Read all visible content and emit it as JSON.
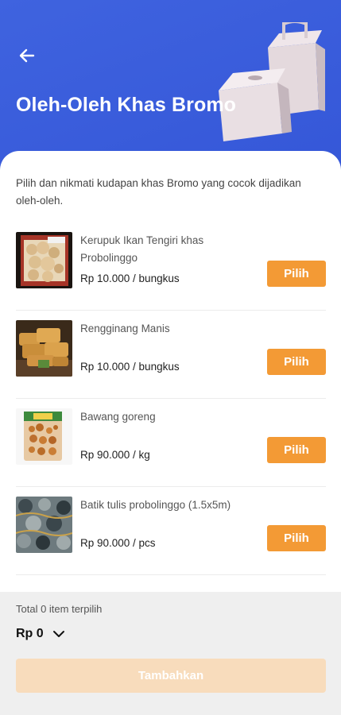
{
  "header": {
    "title": "Oleh-Oleh Khas Bromo",
    "back_icon": "arrow-left-icon",
    "illustration": "gift-boxes-illustration",
    "background_color": "#3f63df"
  },
  "intro_text": "Pilih dan nikmati kudapan khas Bromo yang cocok dijadikan oleh-oleh.",
  "products": [
    {
      "name": "Kerupuk Ikan Tengiri khas Probolinggo",
      "price": "Rp 10.000 / bungkus",
      "button": "Pilih",
      "image": "kerupuk-image"
    },
    {
      "name": "Rengginang Manis",
      "price": "Rp 10.000 / bungkus",
      "button": "Pilih",
      "image": "rengginang-image"
    },
    {
      "name": "Bawang goreng",
      "price": "Rp 90.000 / kg",
      "button": "Pilih",
      "image": "bawang-goreng-image"
    },
    {
      "name": "Batik tulis probolinggo (1.5x5m)",
      "price": "Rp 90.000 / pcs",
      "button": "Pilih",
      "image": "batik-image"
    }
  ],
  "footer": {
    "total_label": "Total 0 item terpilih",
    "total_value": "Rp 0",
    "expand_icon": "chevron-down-icon",
    "submit_label": "Tambahkan"
  },
  "colors": {
    "accent": "#f39a35",
    "accent_disabled": "#f8dcbc",
    "primary": "#3f63df"
  }
}
